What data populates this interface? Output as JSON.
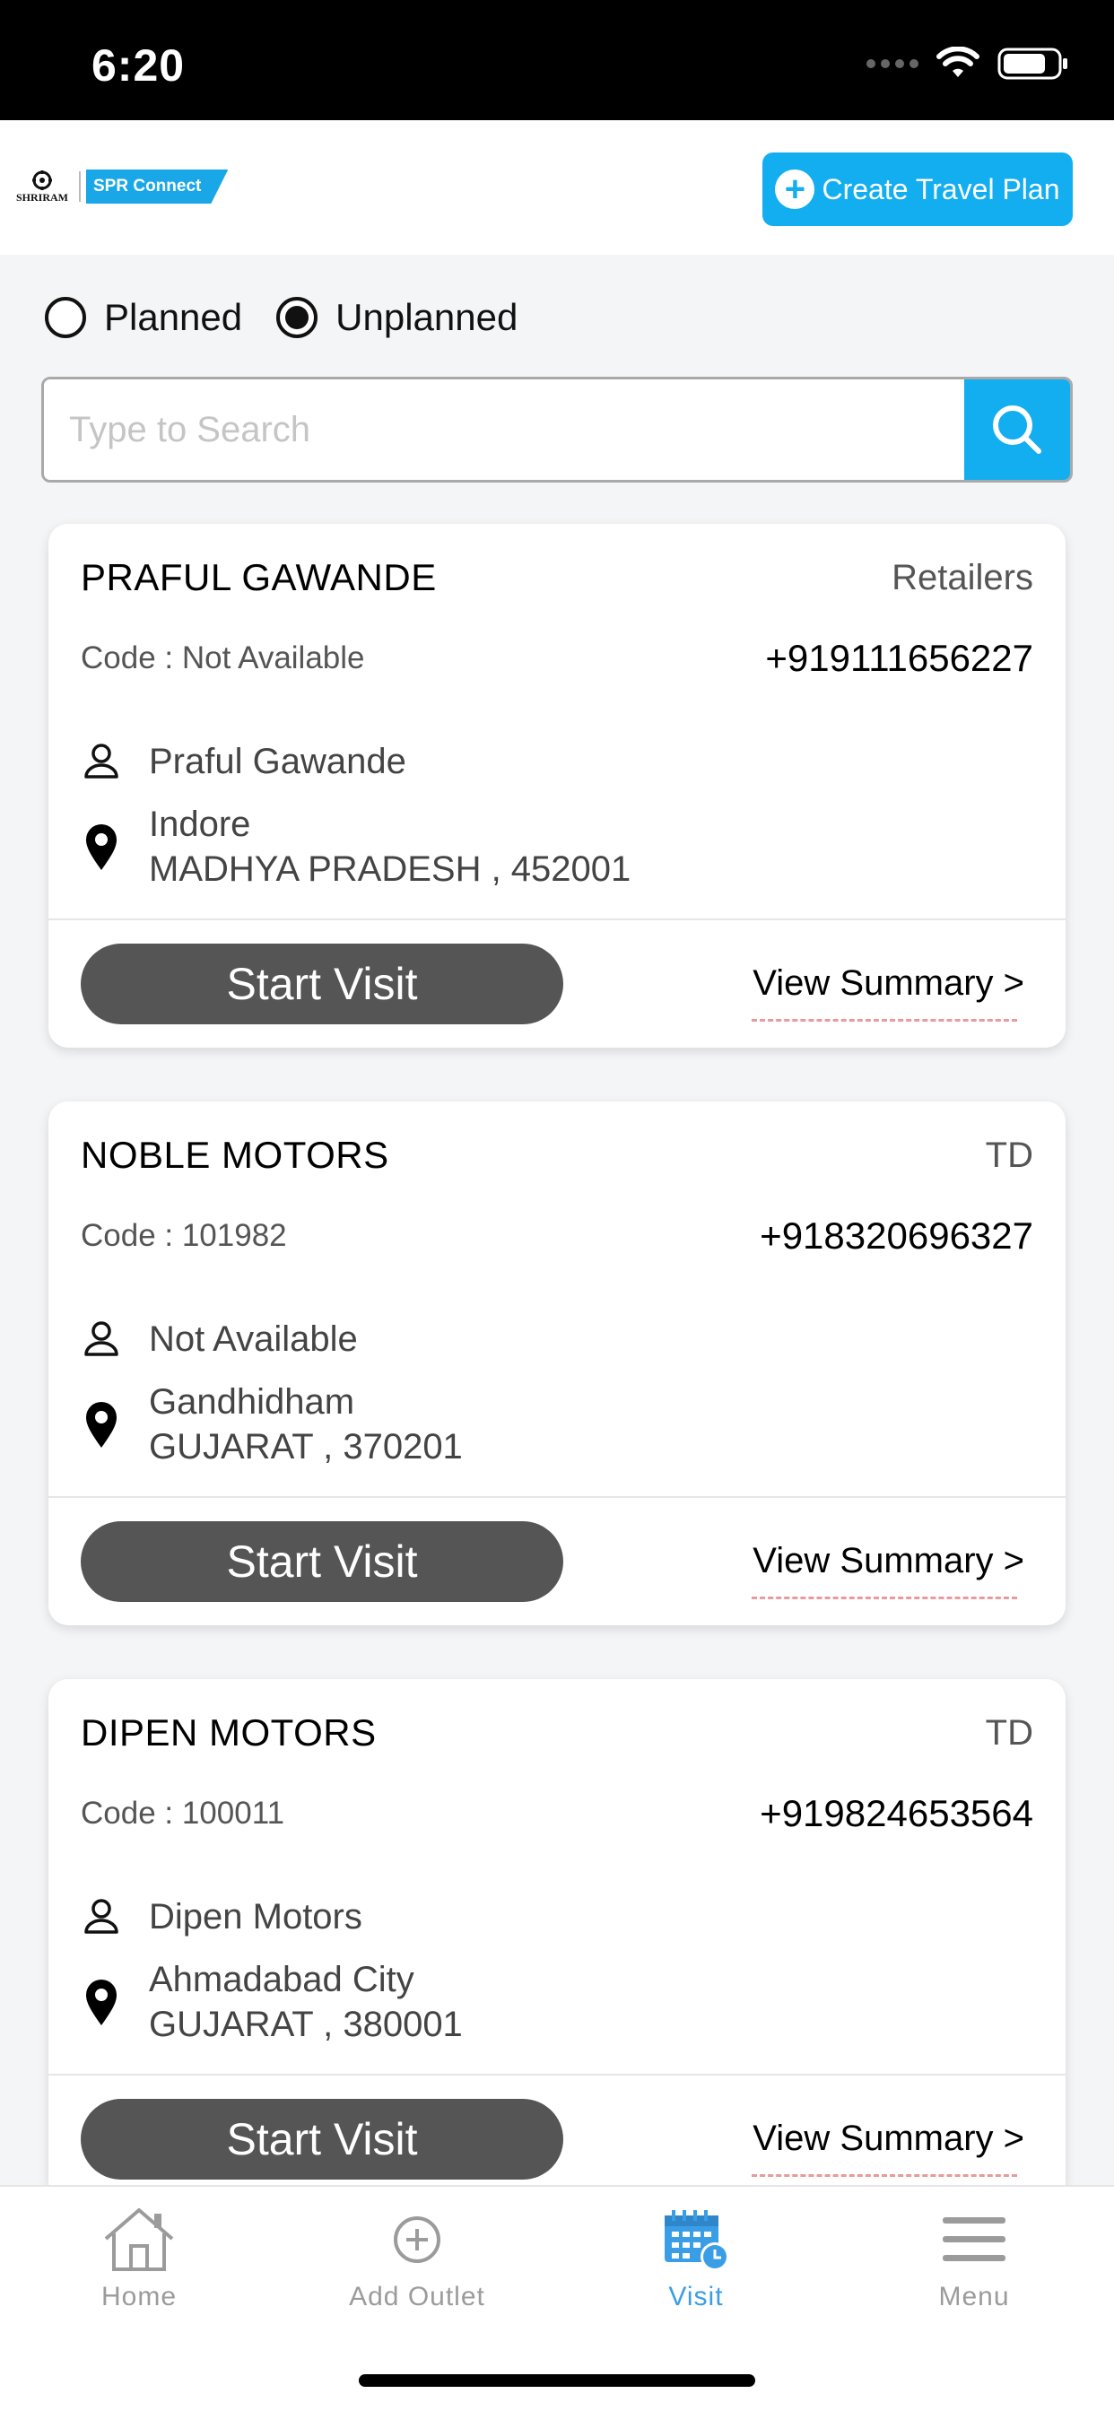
{
  "status_bar": {
    "time": "6:20"
  },
  "header": {
    "logo_text": "SHRIRAM",
    "brand_badge": "SPR Connect",
    "create_button_label": "Create Travel Plan"
  },
  "filter": {
    "options": [
      {
        "label": "Planned",
        "selected": false
      },
      {
        "label": "Unplanned",
        "selected": true
      }
    ]
  },
  "search": {
    "placeholder": "Type to Search"
  },
  "outlets": [
    {
      "name": "PRAFUL GAWANDE",
      "type": "Retailers",
      "code": "Code : Not Available",
      "phone": "+919111656227",
      "contact": "Praful Gawande",
      "city": "Indore",
      "state_pin": "MADHYA PRADESH , 452001",
      "start_label": "Start Visit",
      "summary_label": "View Summary >"
    },
    {
      "name": "NOBLE MOTORS",
      "type": "TD",
      "code": "Code : 101982",
      "phone": "+918320696327",
      "contact": "Not Available",
      "city": "Gandhidham",
      "state_pin": "GUJARAT , 370201",
      "start_label": "Start Visit",
      "summary_label": "View Summary >"
    },
    {
      "name": "DIPEN MOTORS",
      "type": "TD",
      "code": "Code : 100011",
      "phone": "+919824653564",
      "contact": "Dipen Motors",
      "city": "Ahmadabad City",
      "state_pin": "GUJARAT , 380001",
      "start_label": "Start Visit",
      "summary_label": "View Summary >"
    }
  ],
  "bottom_nav": {
    "items": [
      {
        "label": "Home",
        "icon": "home-icon",
        "active": false
      },
      {
        "label": "Add Outlet",
        "icon": "plus-circle-icon",
        "active": false
      },
      {
        "label": "Visit",
        "icon": "calendar-clock-icon",
        "active": true
      },
      {
        "label": "Menu",
        "icon": "hamburger-icon",
        "active": false
      }
    ]
  },
  "colors": {
    "accent": "#12aef0",
    "button_dark": "#555555",
    "nav_active": "#3a9ee6",
    "nav_inactive": "#9b9b9b"
  }
}
